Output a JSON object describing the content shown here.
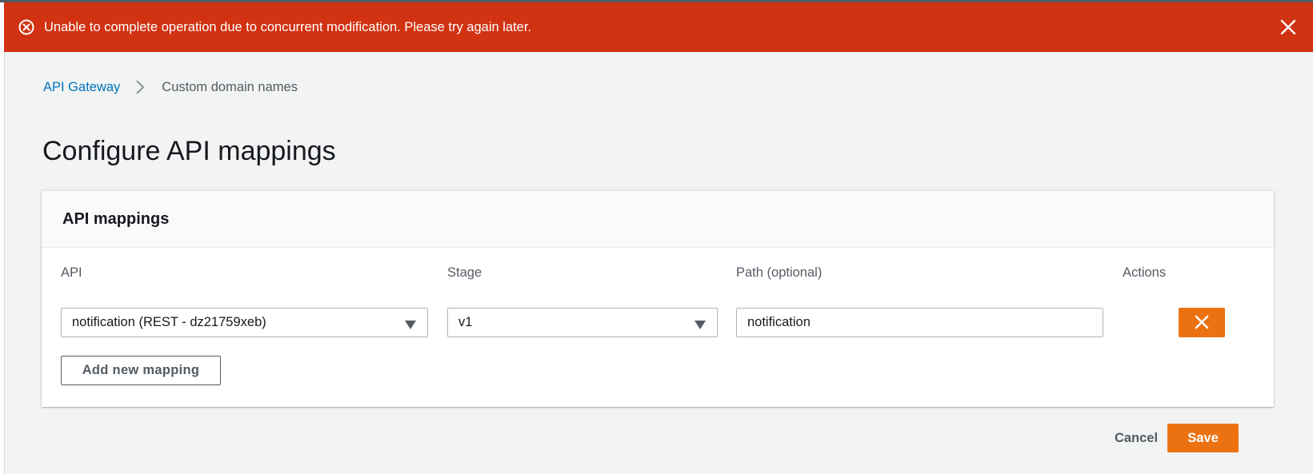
{
  "flash": {
    "message": "Unable to complete operation due to concurrent modification. Please try again later.",
    "type": "error",
    "color": "#d13212"
  },
  "breadcrumb": {
    "items": [
      {
        "label": "API Gateway",
        "link": true
      },
      {
        "label": "Custom domain names",
        "link": false
      }
    ]
  },
  "page": {
    "title": "Configure API mappings"
  },
  "mappings": {
    "title": "API mappings",
    "columns": {
      "api": "API",
      "stage": "Stage",
      "path": "Path (optional)",
      "actions": "Actions"
    },
    "rows": [
      {
        "api": "notification (REST - dz21759xeb)",
        "stage": "v1",
        "path": "notification"
      }
    ],
    "add_label": "Add new mapping"
  },
  "footer": {
    "cancel_label": "Cancel",
    "save_label": "Save"
  },
  "colors": {
    "accent": "#ec7211",
    "link": "#0073bb",
    "error": "#d13212"
  },
  "icons": {
    "flash": "error-circle-icon",
    "dismiss": "close-icon",
    "separator": "chevron-right-icon",
    "dropdown": "caret-down-icon",
    "remove": "close-icon"
  }
}
